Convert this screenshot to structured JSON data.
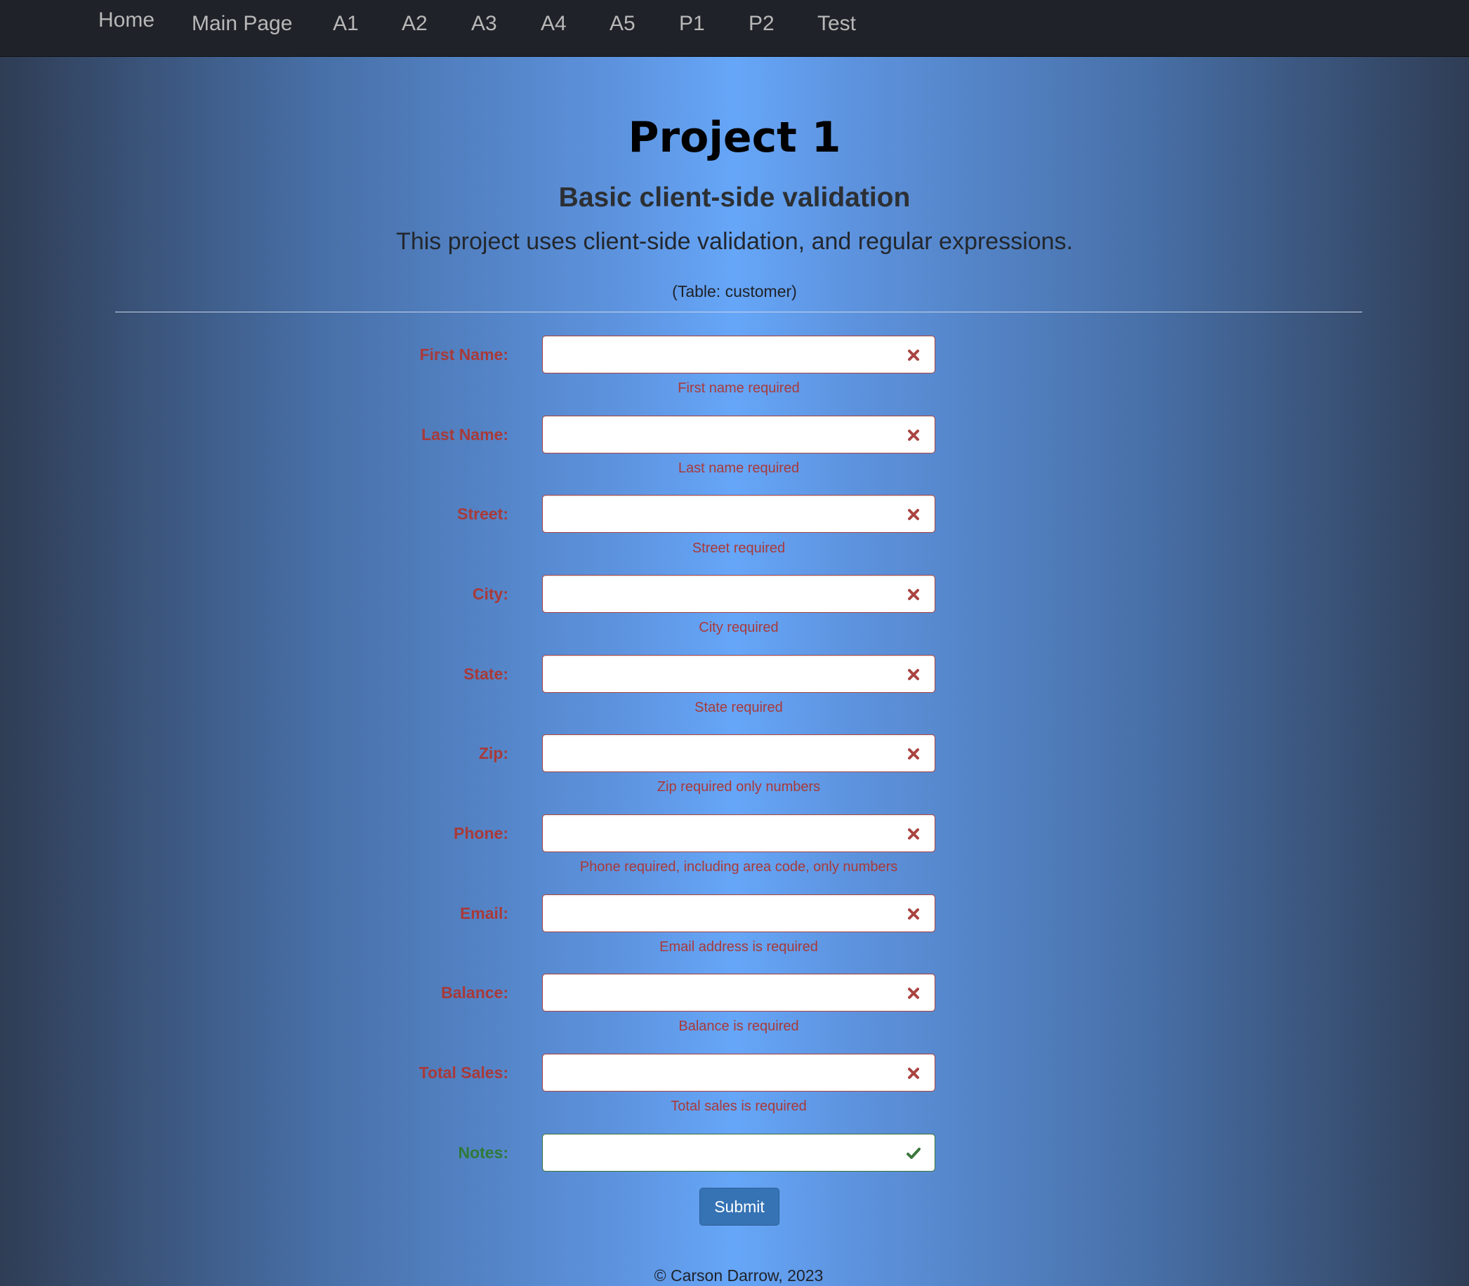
{
  "nav": {
    "items": [
      {
        "label": "Home"
      },
      {
        "label": "Main Page"
      },
      {
        "label": "A1"
      },
      {
        "label": "A2"
      },
      {
        "label": "A3"
      },
      {
        "label": "A4"
      },
      {
        "label": "A5"
      },
      {
        "label": "P1"
      },
      {
        "label": "P2"
      },
      {
        "label": "Test"
      }
    ]
  },
  "header": {
    "title": "Project 1",
    "subtitle": "Basic client-side validation",
    "lead": "This project uses client-side validation, and regular expressions.",
    "table_note": "(Table: customer)"
  },
  "form": {
    "fields": [
      {
        "label": "First Name:",
        "value": "",
        "status": "error",
        "help": "First name required"
      },
      {
        "label": "Last Name:",
        "value": "",
        "status": "error",
        "help": "Last name required"
      },
      {
        "label": "Street:",
        "value": "",
        "status": "error",
        "help": "Street required"
      },
      {
        "label": "City:",
        "value": "",
        "status": "error",
        "help": "City required"
      },
      {
        "label": "State:",
        "value": "",
        "status": "error",
        "help": "State required"
      },
      {
        "label": "Zip:",
        "value": "",
        "status": "error",
        "help": "Zip required only numbers"
      },
      {
        "label": "Phone:",
        "value": "",
        "status": "error",
        "help": "Phone required, including area code, only numbers"
      },
      {
        "label": "Email:",
        "value": "",
        "status": "error",
        "help": "Email address is required"
      },
      {
        "label": "Balance:",
        "value": "",
        "status": "error",
        "help": "Balance is required"
      },
      {
        "label": "Total Sales:",
        "value": "",
        "status": "error",
        "help": "Total sales is required"
      },
      {
        "label": "Notes:",
        "value": "",
        "status": "success",
        "help": ""
      }
    ],
    "submit_label": "Submit"
  },
  "footer": {
    "text": "© Carson Darrow, 2023"
  },
  "colors": {
    "error": "#a94442",
    "success": "#3c763d",
    "navbar": "#1f2228",
    "button": "#3573b5",
    "background_center": "#66a6f8",
    "background_edge": "#2f3d55"
  },
  "icons": {
    "error": "x-mark-icon",
    "success": "check-icon"
  }
}
